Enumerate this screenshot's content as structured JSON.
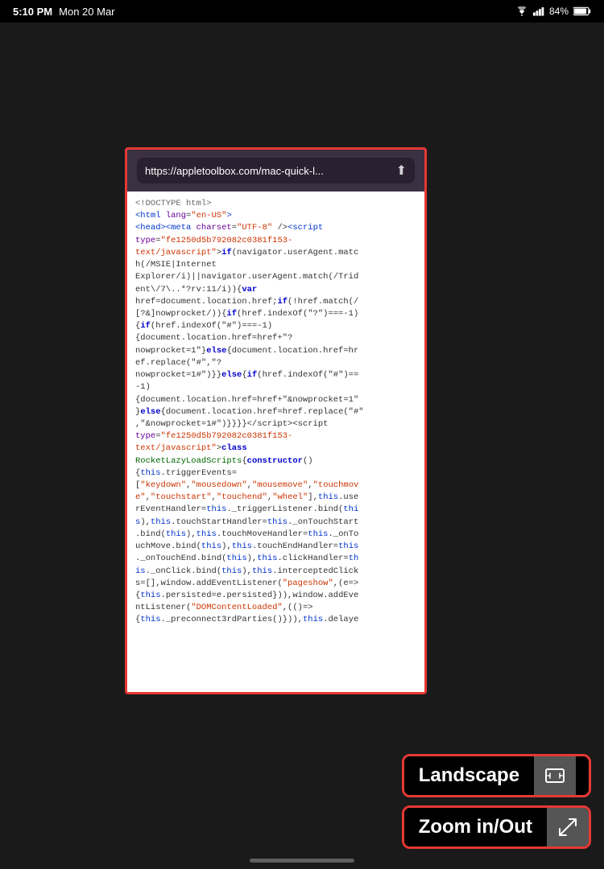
{
  "statusBar": {
    "time": "5:10 PM",
    "date": "Mon 20 Mar",
    "battery": "84%"
  },
  "browser": {
    "url": "https://appletoolbox.com/mac-quick-l...",
    "shareIcon": "⬆"
  },
  "codeContent": "code-display",
  "buttons": [
    {
      "id": "landscape",
      "label": "Landscape",
      "icon": "⤢"
    },
    {
      "id": "zoom",
      "label": "Zoom in/Out",
      "icon": "↙"
    }
  ]
}
